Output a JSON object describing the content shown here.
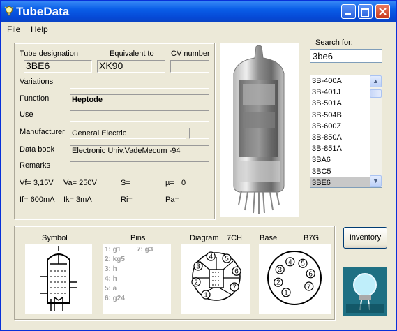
{
  "window": {
    "title": "TubeData"
  },
  "menu": {
    "file": "File",
    "help": "Help"
  },
  "header": {
    "designation": "Tube designation",
    "equivalent": "Equivalent to",
    "cv": "CV number"
  },
  "tube": {
    "designation": "3BE6",
    "equivalent": "XK90",
    "cv_number": "",
    "variations": "",
    "function": "Heptode",
    "use": "",
    "manufacturer": "General Electric",
    "manufacturer_extra": "",
    "data_book": "Electronic Univ.VadeMecum -94",
    "remarks": ""
  },
  "labels": {
    "variations": "Variations",
    "function": "Function",
    "use": "Use",
    "manufacturer": "Manufacturer",
    "data_book": "Data book",
    "remarks": "Remarks"
  },
  "params": {
    "vf": "Vf= 3,15V",
    "va": "Va= 250V",
    "s": "S=",
    "mu": "µ=",
    "mu_val": "0",
    "if": "If= 600mA",
    "ik": "Ik= 3mA",
    "ri": "Ri=",
    "pa": "Pa="
  },
  "search": {
    "label": "Search for:",
    "value": "3be6"
  },
  "list": {
    "items": [
      "3B-400A",
      "3B-401J",
      "3B-501A",
      "3B-504B",
      "3B-600Z",
      "3B-850A",
      "3B-851A",
      "3BA6",
      "3BC5",
      "3BE6"
    ],
    "selected": "3BE6"
  },
  "bottom": {
    "symbol": "Symbol",
    "pins": "Pins",
    "diagram": "Diagram",
    "diagram_code": "7CH",
    "base": "Base",
    "base_code": "B7G"
  },
  "pins": {
    "p1": "1: g1",
    "p7": "7: g3",
    "p2": "2: kg5",
    "p3": "3: h",
    "p4": "4: h",
    "p5": "5: a",
    "p6": "6: g24"
  },
  "diagram_pins": [
    "1",
    "2",
    "3",
    "4",
    "5",
    "6",
    "7"
  ],
  "base_pins": [
    "1",
    "2",
    "3",
    "4",
    "5",
    "6",
    "7"
  ],
  "inventory": {
    "label": "Inventory"
  }
}
